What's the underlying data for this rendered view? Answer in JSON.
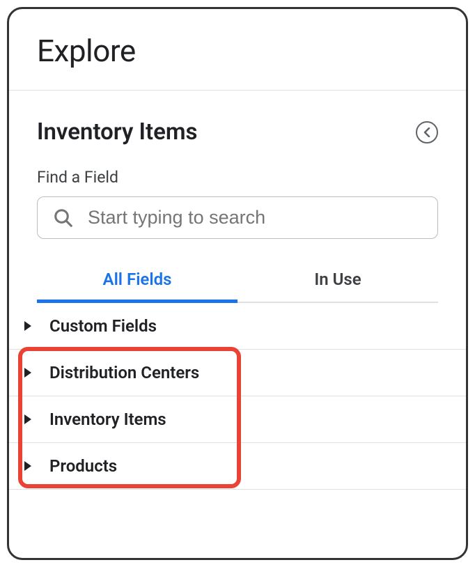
{
  "header": {
    "title": "Explore"
  },
  "section": {
    "title": "Inventory Items",
    "find_label": "Find a Field",
    "search_placeholder": "Start typing to search"
  },
  "tabs": {
    "all_fields": "All Fields",
    "in_use": "In Use"
  },
  "fields": {
    "custom": "Custom Fields",
    "distribution": "Distribution Centers",
    "inventory": "Inventory Items",
    "products": "Products"
  }
}
